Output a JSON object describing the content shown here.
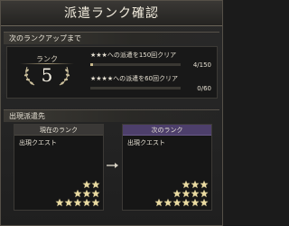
{
  "title": "派遣ランク確認",
  "next_rank": {
    "section_label": "次のランクアップまで",
    "rank_label": "ランク",
    "rank_value": "5",
    "conditions": [
      {
        "text": "★★★への派遣を150回クリア",
        "count": "4/150",
        "progress": 0.027
      },
      {
        "text": "★★★★への派遣を60回クリア",
        "count": "0/60",
        "progress": 0.0
      }
    ]
  },
  "destinations": {
    "section_label": "出現派遣先",
    "current": {
      "header": "現在のランク",
      "sub": "出現クエスト"
    },
    "next": {
      "header": "次のランク",
      "sub": "出現クエスト"
    }
  },
  "colors": {
    "star": "#e8d9a0",
    "next_header": "#4d3f6b"
  }
}
